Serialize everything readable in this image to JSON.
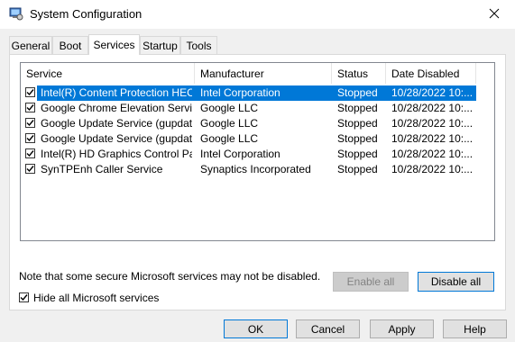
{
  "window": {
    "title": "System Configuration"
  },
  "tabs": [
    {
      "label": "General"
    },
    {
      "label": "Boot"
    },
    {
      "label": "Services"
    },
    {
      "label": "Startup"
    },
    {
      "label": "Tools"
    }
  ],
  "active_tab": "Services",
  "columns": [
    "Service",
    "Manufacturer",
    "Status",
    "Date Disabled"
  ],
  "services": [
    {
      "name": "Intel(R) Content Protection HEC...",
      "manufacturer": "Intel Corporation",
      "status": "Stopped",
      "date": "10/28/2022 10:...",
      "checked": true,
      "selected": true
    },
    {
      "name": "Google Chrome Elevation Servic...",
      "manufacturer": "Google LLC",
      "status": "Stopped",
      "date": "10/28/2022 10:...",
      "checked": true,
      "selected": false
    },
    {
      "name": "Google Update Service (gupdate)",
      "manufacturer": "Google LLC",
      "status": "Stopped",
      "date": "10/28/2022 10:...",
      "checked": true,
      "selected": false
    },
    {
      "name": "Google Update Service (gupdatem)",
      "manufacturer": "Google LLC",
      "status": "Stopped",
      "date": "10/28/2022 10:...",
      "checked": true,
      "selected": false
    },
    {
      "name": "Intel(R) HD Graphics Control Pa...",
      "manufacturer": "Intel Corporation",
      "status": "Stopped",
      "date": "10/28/2022 10:...",
      "checked": true,
      "selected": false
    },
    {
      "name": "SynTPEnh Caller Service",
      "manufacturer": "Synaptics Incorporated",
      "status": "Stopped",
      "date": "10/28/2022 10:...",
      "checked": true,
      "selected": false
    }
  ],
  "note": "Note that some secure Microsoft services may not be disabled.",
  "enable_all": "Enable all",
  "disable_all": "Disable all",
  "hide_ms": {
    "label": "Hide all Microsoft services",
    "checked": true
  },
  "buttons": {
    "ok": "OK",
    "cancel": "Cancel",
    "apply": "Apply",
    "help": "Help"
  },
  "colors": {
    "selection": "#0078d7",
    "focus_border": "#0078d7"
  }
}
